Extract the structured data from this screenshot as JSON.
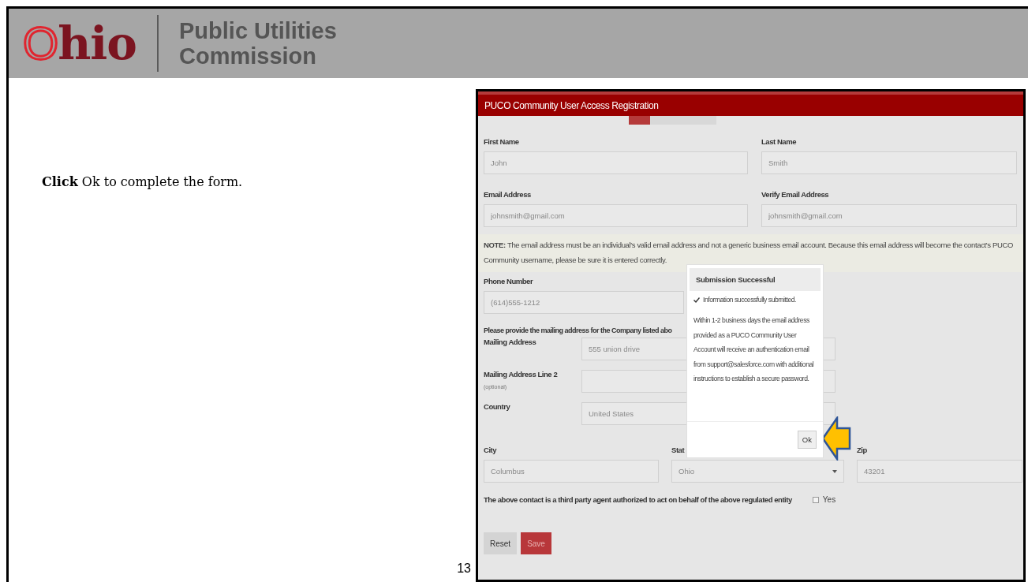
{
  "header": {
    "logo": "Ohio",
    "org_name": [
      "Public Utilities",
      "Commission"
    ]
  },
  "instruction": "**Click** Ok to complete the form.",
  "page_number": "13",
  "form": {
    "title": "PUCO Community User Access Registration",
    "progress": {
      "level": 0.24
    },
    "name_row": [
      {
        "label": "First Name",
        "value": "John"
      },
      {
        "label": "Last Name",
        "value": "Smith"
      }
    ],
    "email_row": [
      {
        "label": "Email Address",
        "value": "johnsmith@gmail.com"
      },
      {
        "label": "Verify Email Address",
        "value": "johnsmith@gmail.com"
      }
    ],
    "note": "**NOTE:** The email address must be an individual's valid email address and not a generic business email account. Because this email address will become the contact's PUCO Community username, please be sure it is entered correctly.",
    "phone": {
      "label": "Phone Number",
      "value": "(614)555-1212"
    },
    "address_intro": "Please provide the mailing address for the Company listed abo",
    "address_fields": [
      {
        "label": "Mailing Address",
        "value": "555 union drive"
      },
      {
        "label": "Mailing Address Line 2",
        "hint": "(optional)"
      },
      {
        "label": "Country",
        "value": "United States"
      }
    ],
    "location_row": [
      {
        "kind": "text",
        "label": "City",
        "value": "Columbus"
      },
      {
        "kind": "select",
        "label": "Stat",
        "value": "Ohio"
      },
      {
        "kind": "text",
        "label": "Zip",
        "value": "43201"
      }
    ],
    "agent": {
      "text": "The above contact is a third party agent authorized to act on behalf of the above regulated entity",
      "option": "Yes",
      "checked": false
    },
    "buttons": [
      {
        "kind": "reset",
        "label": "Reset"
      },
      {
        "kind": "save",
        "label": "Save"
      }
    ]
  },
  "dialog": {
    "title": "Submission Successful",
    "status": "Information successfully submitted.",
    "message": "Within 1-2 business days the email address provided as a PUCO Community User Account will receive an authentication email from support@salesforce.com with additional instructions to establish a secure password.",
    "button": "Ok"
  }
}
